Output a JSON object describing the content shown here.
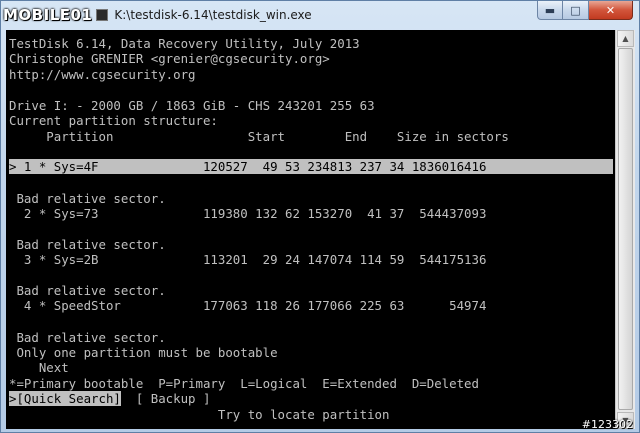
{
  "window": {
    "logo_text": "MOBILE01",
    "title": "K:\\testdisk-6.14\\testdisk_win.exe",
    "min_glyph": "▬",
    "max_glyph": "□",
    "close_glyph": "✕"
  },
  "console": {
    "header": [
      "TestDisk 6.14, Data Recovery Utility, July 2013",
      "Christophe GRENIER <grenier@cgsecurity.org>",
      "http://www.cgsecurity.org"
    ],
    "drive_info": "Drive I: - 2000 GB / 1863 GiB - CHS 243201 255 63",
    "structure_label": "Current partition structure:",
    "columns_line": "     Partition                  Start        End    Size in sectors",
    "partitions": [
      {
        "line": "> 1 * Sys=4F              120527  49 53 234813 237 34 1836016416",
        "selected": true
      },
      {
        "warning": " Bad relative sector.",
        "line": "  2 * Sys=73              119380 132 62 153270  41 37  544437093"
      },
      {
        "warning": " Bad relative sector.",
        "line": "  3 * Sys=2B              113201  29 24 147074 114 59  544175136"
      },
      {
        "warning": " Bad relative sector.",
        "line": "  4 * SpeedStor           177063 118 26 177066 225 63      54974"
      }
    ],
    "final_warning": " Bad relative sector.",
    "bootable_message": " Only one partition must be bootable",
    "next_label": "    Next",
    "legend": "*=Primary bootable  P=Primary  L=Logical  E=Extended  D=Deleted",
    "menu": {
      "quick_search": ">[Quick Search]",
      "backup": "  [ Backup ]"
    },
    "hint": "                            Try to locate partition"
  },
  "watermark": "#123302"
}
